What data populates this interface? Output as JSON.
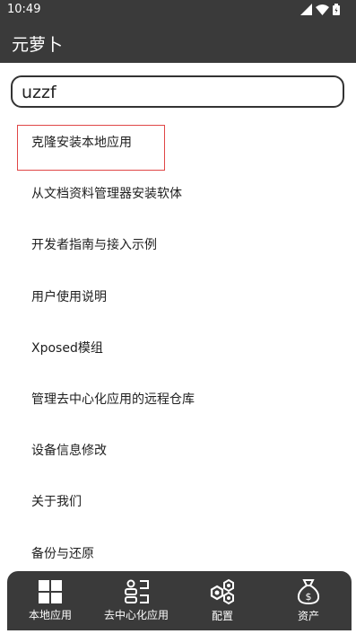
{
  "status_bar": {
    "time": "10:49"
  },
  "app_bar": {
    "title": "元萝卜"
  },
  "search": {
    "value": "uzzf"
  },
  "menu": {
    "items": [
      {
        "label": "克隆安装本地应用"
      },
      {
        "label": "从文档资料管理器安装软体"
      },
      {
        "label": "开发者指南与接入示例"
      },
      {
        "label": "用户使用说明"
      },
      {
        "label": "Xposed模组"
      },
      {
        "label": "管理去中心化应用的远程仓库"
      },
      {
        "label": "设备信息修改"
      },
      {
        "label": "关于我们"
      },
      {
        "label": "备份与还原"
      }
    ]
  },
  "bottom_nav": {
    "items": [
      {
        "label": "本地应用",
        "icon": "grid-icon"
      },
      {
        "label": "去中心化应用",
        "icon": "people-icon"
      },
      {
        "label": "配置",
        "icon": "hexagon-gear-icon"
      },
      {
        "label": "资产",
        "icon": "money-bag-icon"
      }
    ]
  },
  "colors": {
    "bar_bg": "#3a3a3a",
    "highlight_border": "#e04646"
  }
}
